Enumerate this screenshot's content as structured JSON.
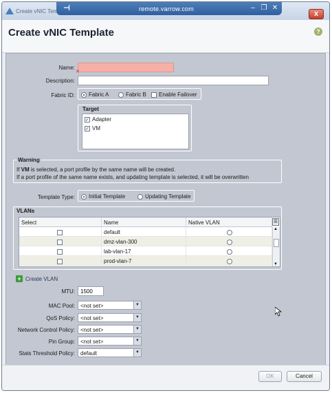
{
  "window": {
    "title": "Create vNIC Template",
    "remote_host": "remote.varrow.com",
    "close_glyph": "x"
  },
  "header": {
    "title": "Create vNIC Template"
  },
  "form": {
    "name_label": "Name:",
    "name_value": "",
    "description_label": "Description:",
    "description_value": "",
    "fabric_label": "Fabric ID:",
    "fabric_a": "Fabric A",
    "fabric_b": "Fabric B",
    "enable_failover": "Enable Failover",
    "fabric_selected": "Fabric A",
    "target_title": "Target",
    "targets": [
      {
        "label": "Adapter",
        "checked": true
      },
      {
        "label": "VM",
        "checked": true
      }
    ],
    "warning_title": "Warning",
    "warning_line1_pre": "If ",
    "warning_line1_bold": "VM",
    "warning_line1_post": " is selected, a port profile by the same name will be created.",
    "warning_line2": "If a port profile of the same name exists, and updating template is selected, it will be overwritten",
    "template_type_label": "Template Type:",
    "template_initial": "Initial Template",
    "template_updating": "Updating Template",
    "template_selected": "Initial Template",
    "vlans_title": "VLANs",
    "vlan_columns": [
      "Select",
      "Name",
      "Native VLAN"
    ],
    "vlans": [
      {
        "name": "default",
        "selected": false,
        "native": false
      },
      {
        "name": "dmz-vlan-300",
        "selected": false,
        "native": false
      },
      {
        "name": "lab-vlan-17",
        "selected": false,
        "native": false
      },
      {
        "name": "prod-vlan-7",
        "selected": false,
        "native": false
      }
    ],
    "create_vlan": "Create VLAN",
    "mtu_label": "MTU:",
    "mtu_value": "1500",
    "mac_pool_label": "MAC Pool:",
    "mac_pool_value": "<not set>",
    "qos_label": "QoS Policy:",
    "qos_value": "<not set>",
    "ncp_label": "Network Control Policy:",
    "ncp_value": "<not set>",
    "pin_group_label": "Pin Group:",
    "pin_group_value": "<not set>",
    "stats_label": "Stats Threshold Policy:",
    "stats_value": "default"
  },
  "footer": {
    "ok": "OK",
    "cancel": "Cancel"
  },
  "colors": {
    "error_field": "#f6b0a8",
    "panel": "#c2c7d1",
    "title_bar": "#2f5f9f"
  }
}
